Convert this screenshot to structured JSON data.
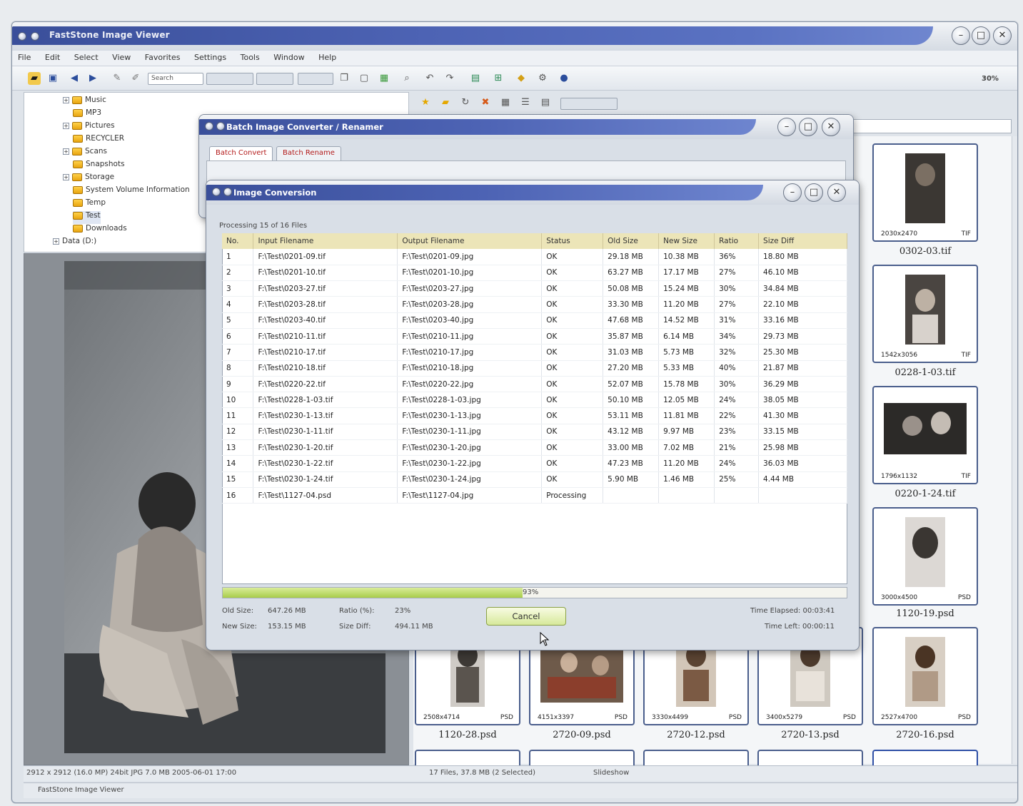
{
  "main": {
    "title": "FastStone Image Viewer",
    "menu": [
      "File",
      "Edit",
      "Select",
      "View",
      "Favorites",
      "Settings",
      "Tools",
      "Window",
      "Help"
    ],
    "toolbar": {
      "search_label": "Search",
      "zoom_label": "30%"
    },
    "tree": [
      "Music",
      "MP3",
      "Pictures",
      "RECYCLER",
      "Scans",
      "Snapshots",
      "Storage",
      "System Volume Information",
      "Temp",
      "Test",
      "Downloads",
      "Data (D:)"
    ],
    "status_left": "2912 x 2912 (16.0 MP) 24bit JPG 7.0 MB 2005-06-01 17:00",
    "status_mid": "17 Files, 37.8 MB (2 Selected)",
    "status_mid_right": "Slideshow",
    "status_bottom": "FastStone Image Viewer",
    "thumbnails": [
      {
        "dims": "2030x2470",
        "fmt": "TIF",
        "name": "0302-03.tif"
      },
      {
        "dims": "1542x3056",
        "fmt": "TIF",
        "name": "0228-1-03.tif"
      },
      {
        "dims": "1796x1132",
        "fmt": "TIF",
        "name": "0220-1-24.tif"
      },
      {
        "dims": "3000x4500",
        "fmt": "PSD",
        "name": "1120-19.psd"
      },
      {
        "dims": "2508x4714",
        "fmt": "PSD",
        "name": "1120-28.psd"
      },
      {
        "dims": "4151x3397",
        "fmt": "PSD",
        "name": "2720-09.psd"
      },
      {
        "dims": "3330x4499",
        "fmt": "PSD",
        "name": "2720-12.psd"
      },
      {
        "dims": "3400x5279",
        "fmt": "PSD",
        "name": "2720-13.psd"
      },
      {
        "dims": "2527x4700",
        "fmt": "PSD",
        "name": "2720-16.psd"
      }
    ]
  },
  "batch": {
    "title": "Batch Image Converter / Renamer",
    "tabs": [
      "Batch Convert",
      "Batch Rename"
    ]
  },
  "convert": {
    "title": "Image Conversion",
    "caption": "Processing 15 of 16 Files",
    "columns": [
      "No.",
      "Input Filename",
      "Output Filename",
      "Status",
      "Old Size",
      "New Size",
      "Ratio",
      "Size Diff"
    ],
    "rows": [
      [
        "1",
        "F:\\Test\\0201-09.tif",
        "F:\\Test\\0201-09.jpg",
        "OK",
        "29.18 MB",
        "10.38 MB",
        "36%",
        "18.80 MB"
      ],
      [
        "2",
        "F:\\Test\\0201-10.tif",
        "F:\\Test\\0201-10.jpg",
        "OK",
        "63.27 MB",
        "17.17 MB",
        "27%",
        "46.10 MB"
      ],
      [
        "3",
        "F:\\Test\\0203-27.tif",
        "F:\\Test\\0203-27.jpg",
        "OK",
        "50.08 MB",
        "15.24 MB",
        "30%",
        "34.84 MB"
      ],
      [
        "4",
        "F:\\Test\\0203-28.tif",
        "F:\\Test\\0203-28.jpg",
        "OK",
        "33.30 MB",
        "11.20 MB",
        "27%",
        "22.10 MB"
      ],
      [
        "5",
        "F:\\Test\\0203-40.tif",
        "F:\\Test\\0203-40.jpg",
        "OK",
        "47.68 MB",
        "14.52 MB",
        "31%",
        "33.16 MB"
      ],
      [
        "6",
        "F:\\Test\\0210-11.tif",
        "F:\\Test\\0210-11.jpg",
        "OK",
        "35.87 MB",
        "6.14 MB",
        "34%",
        "29.73 MB"
      ],
      [
        "7",
        "F:\\Test\\0210-17.tif",
        "F:\\Test\\0210-17.jpg",
        "OK",
        "31.03 MB",
        "5.73 MB",
        "32%",
        "25.30 MB"
      ],
      [
        "8",
        "F:\\Test\\0210-18.tif",
        "F:\\Test\\0210-18.jpg",
        "OK",
        "27.20 MB",
        "5.33 MB",
        "40%",
        "21.87 MB"
      ],
      [
        "9",
        "F:\\Test\\0220-22.tif",
        "F:\\Test\\0220-22.jpg",
        "OK",
        "52.07 MB",
        "15.78 MB",
        "30%",
        "36.29 MB"
      ],
      [
        "10",
        "F:\\Test\\0228-1-03.tif",
        "F:\\Test\\0228-1-03.jpg",
        "OK",
        "50.10 MB",
        "12.05 MB",
        "24%",
        "38.05 MB"
      ],
      [
        "11",
        "F:\\Test\\0230-1-13.tif",
        "F:\\Test\\0230-1-13.jpg",
        "OK",
        "53.11 MB",
        "11.81 MB",
        "22%",
        "41.30 MB"
      ],
      [
        "12",
        "F:\\Test\\0230-1-11.tif",
        "F:\\Test\\0230-1-11.jpg",
        "OK",
        "43.12 MB",
        "9.97 MB",
        "23%",
        "33.15 MB"
      ],
      [
        "13",
        "F:\\Test\\0230-1-20.tif",
        "F:\\Test\\0230-1-20.jpg",
        "OK",
        "33.00 MB",
        "7.02 MB",
        "21%",
        "25.98 MB"
      ],
      [
        "14",
        "F:\\Test\\0230-1-22.tif",
        "F:\\Test\\0230-1-22.jpg",
        "OK",
        "47.23 MB",
        "11.20 MB",
        "24%",
        "36.03 MB"
      ],
      [
        "15",
        "F:\\Test\\0230-1-24.tif",
        "F:\\Test\\0230-1-24.jpg",
        "OK",
        "5.90 MB",
        "1.46 MB",
        "25%",
        "4.44 MB"
      ],
      [
        "16",
        "F:\\Test\\1127-04.psd",
        "F:\\Test\\1127-04.jpg",
        "Processing",
        "",
        "",
        "",
        ""
      ]
    ],
    "progress_label": "93%",
    "progress_fraction": 0.48,
    "old_size_label": "Old Size:",
    "old_size_value": "647.26 MB",
    "new_size_label": "New Size:",
    "new_size_value": "153.15 MB",
    "ratio_label": "Ratio (%):",
    "ratio_value": "23%",
    "diff_label": "Size Diff:",
    "diff_value": "494.11 MB",
    "elapsed": "Time Elapsed: 00:03:41",
    "remaining": "Time Left: 00:00:11",
    "cancel_label": "Cancel"
  }
}
